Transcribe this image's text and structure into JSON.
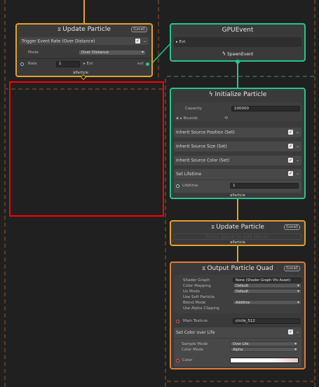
{
  "update_particle_top": {
    "title": "Update Particle",
    "badge": "(Local)",
    "block_label": "Trigger Event Rate (Over Distance)",
    "mode_label": "Mode",
    "mode_value": "Over Distance",
    "rate_label": "Rate",
    "rate_value": "1",
    "evt_in_label": "Evt",
    "evt_out_label": "evt",
    "output_label": "Particle"
  },
  "gpu_event": {
    "title": "GPUEvent",
    "evt_label": "Evt",
    "spawn_label": "SpawnEvent"
  },
  "initialize": {
    "title": "Initialize Particle",
    "capacity_label": "Capacity",
    "capacity_value": "100000",
    "bounds_label": "Bounds",
    "blocks": [
      "Inherit Source Position (Set)",
      "Inherit Source Size (Set)",
      "Inherit Source Color (Set)",
      "Set Lifetime"
    ],
    "lifetime_label": "Lifetime",
    "lifetime_value": "1",
    "output_label": "Particle"
  },
  "update_particle": {
    "title": "Update Particle",
    "badge": "(Local)",
    "placeholder": "Press space to add blocks",
    "output_label": "Particle"
  },
  "output_quad": {
    "title": "Output Particle Quad",
    "badge": "(Local)",
    "fields": [
      {
        "label": "Shader Graph",
        "value": "None (Shader Graph Vfx Asset)"
      },
      {
        "label": "Color Mapping",
        "value": "Default"
      },
      {
        "label": "Uv Mode",
        "value": "Default"
      },
      {
        "label": "Use Soft Particle",
        "value": ""
      },
      {
        "label": "Blend Mode",
        "value": "Additive"
      },
      {
        "label": "Use Alpha Clipping",
        "value": ""
      }
    ],
    "main_texture_label": "Main Texture",
    "main_texture_value": "circle_512",
    "color_block_label": "Set Color over Life",
    "sample_mode_label": "Sample Mode",
    "sample_mode_value": "Over Life",
    "color_mode_label": "Color Mode",
    "color_mode_value": "Alpha",
    "color_label": "Color"
  },
  "colors": {
    "orange_border": "#e3a02b",
    "green_border": "#27c48a",
    "selection": "#ff0000"
  }
}
